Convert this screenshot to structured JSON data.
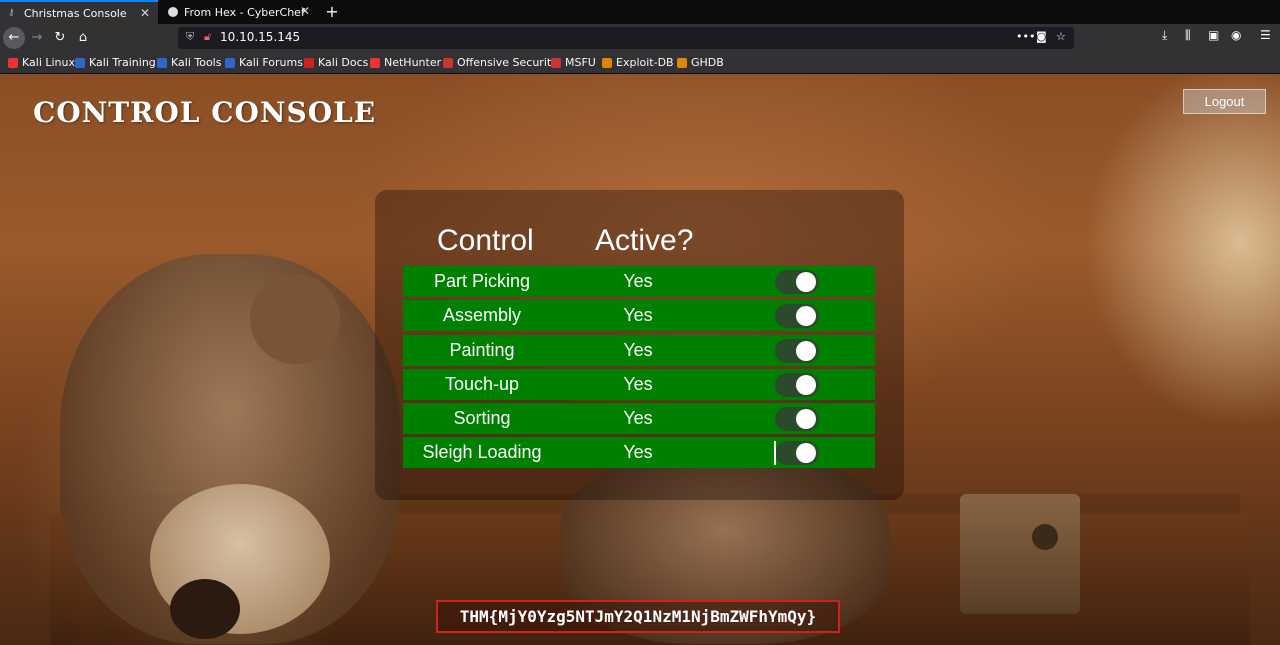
{
  "browser": {
    "tabs": [
      {
        "label": "Christmas Console",
        "active": true
      },
      {
        "label": "From Hex - CyberChef",
        "active": false
      }
    ],
    "new_tab_label": "+",
    "url": "10.10.15.145",
    "bookmarks": [
      {
        "label": "Kali Linux",
        "color": "#e33"
      },
      {
        "label": "Kali Training",
        "color": "#36c"
      },
      {
        "label": "Kali Tools",
        "color": "#36c"
      },
      {
        "label": "Kali Forums",
        "color": "#36c"
      },
      {
        "label": "Kali Docs",
        "color": "#c22"
      },
      {
        "label": "NetHunter",
        "color": "#e33"
      },
      {
        "label": "Offensive Security",
        "color": "#c33"
      },
      {
        "label": "MSFU",
        "color": "#c33"
      },
      {
        "label": "Exploit-DB",
        "color": "#d80"
      },
      {
        "label": "GHDB",
        "color": "#d80"
      }
    ]
  },
  "page": {
    "title": "CONTROL CONSOLE",
    "logout_label": "Logout",
    "table": {
      "headers": [
        "Control",
        "Active?"
      ],
      "rows": [
        {
          "name": "Part Picking",
          "status": "Yes",
          "on": true
        },
        {
          "name": "Assembly",
          "status": "Yes",
          "on": true
        },
        {
          "name": "Painting",
          "status": "Yes",
          "on": true
        },
        {
          "name": "Touch-up",
          "status": "Yes",
          "on": true
        },
        {
          "name": "Sorting",
          "status": "Yes",
          "on": true
        },
        {
          "name": "Sleigh Loading",
          "status": "Yes",
          "on": true
        }
      ]
    },
    "flag": "THM{MjY0Yzg5NTJmY2Q1NzM1NjBmZWFhYmQy}"
  }
}
